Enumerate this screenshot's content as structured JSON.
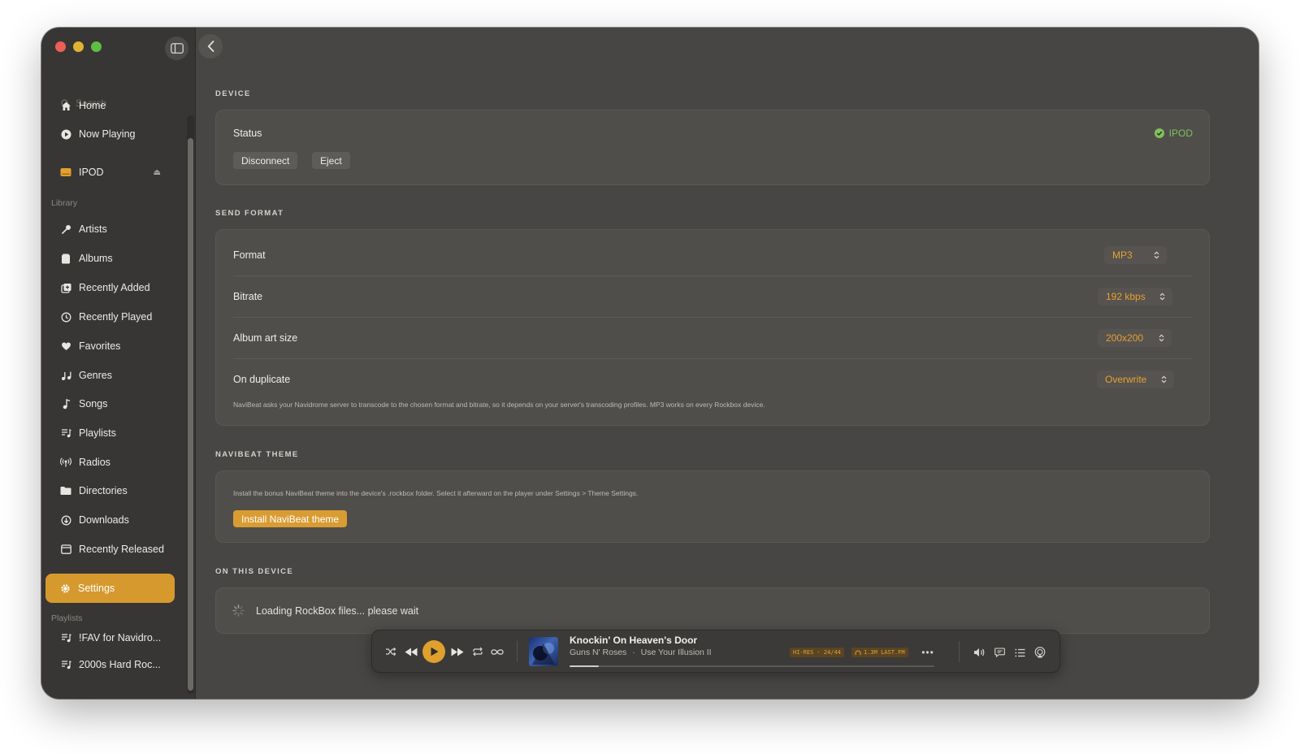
{
  "sidebar": {
    "search_placeholder": "Search",
    "nav": [
      {
        "label": "Home",
        "icon": "home-icon"
      },
      {
        "label": "Now Playing",
        "icon": "play-circle-icon"
      }
    ],
    "device": {
      "label": "IPOD",
      "icon": "drive-icon",
      "eject_icon": "eject-icon"
    },
    "library_label": "Library",
    "library": [
      {
        "label": "Artists",
        "icon": "microphone-icon"
      },
      {
        "label": "Albums",
        "icon": "album-icon"
      },
      {
        "label": "Recently Added",
        "icon": "recently-added-icon"
      },
      {
        "label": "Recently Played",
        "icon": "history-icon"
      },
      {
        "label": "Favorites",
        "icon": "heart-icon"
      },
      {
        "label": "Genres",
        "icon": "genres-icon"
      },
      {
        "label": "Songs",
        "icon": "music-note-icon"
      },
      {
        "label": "Playlists",
        "icon": "playlist-icon"
      },
      {
        "label": "Radios",
        "icon": "radio-icon"
      },
      {
        "label": "Directories",
        "icon": "folder-icon"
      },
      {
        "label": "Downloads",
        "icon": "download-icon"
      },
      {
        "label": "Recently Released",
        "icon": "calendar-icon"
      }
    ],
    "settings": {
      "label": "Settings",
      "icon": "gear-icon"
    },
    "playlists_label": "Playlists",
    "playlists": [
      {
        "label": "!FAV for Navidro...",
        "icon": "playlist-icon"
      },
      {
        "label": "2000s Hard Roc...",
        "icon": "playlist-icon"
      }
    ]
  },
  "main": {
    "device_section": {
      "title": "DEVICE",
      "status_label": "Status",
      "status_value": "IPOD",
      "status_color": "#7fc15a",
      "disconnect_label": "Disconnect",
      "eject_label": "Eject"
    },
    "send_format": {
      "title": "SEND FORMAT",
      "rows": [
        {
          "label": "Format",
          "value": "MP3"
        },
        {
          "label": "Bitrate",
          "value": "192 kbps"
        },
        {
          "label": "Album art size",
          "value": "200x200"
        },
        {
          "label": "On duplicate",
          "value": "Overwrite"
        }
      ],
      "note": "NaviBeat asks your Navidrome server to transcode to the chosen format and bitrate, so it depends on your server's transcoding profiles. MP3 works on every Rockbox device."
    },
    "theme": {
      "title": "NAVIBEAT THEME",
      "note": "Install the bonus NaviBeat theme into the device's .rockbox folder. Select it afterward on the player under Settings > Theme Settings.",
      "install_label": "Install NaviBeat theme"
    },
    "on_device": {
      "title": "ON THIS DEVICE",
      "loading_text": "Loading RockBox files... please wait"
    }
  },
  "player": {
    "title": "Knockin' On Heaven's Door",
    "artist": "Guns N' Roses",
    "separator": "·",
    "album": "Use Your Illusion II",
    "quality_badge": "HI-RES · 24/44",
    "scrobble_badge": "1.3M LAST.FM",
    "progress": 0.08,
    "accent": "#e0a02e"
  },
  "colors": {
    "accent": "#d6992e",
    "window_bg": "#484644",
    "sidebar_bg": "#383634"
  }
}
